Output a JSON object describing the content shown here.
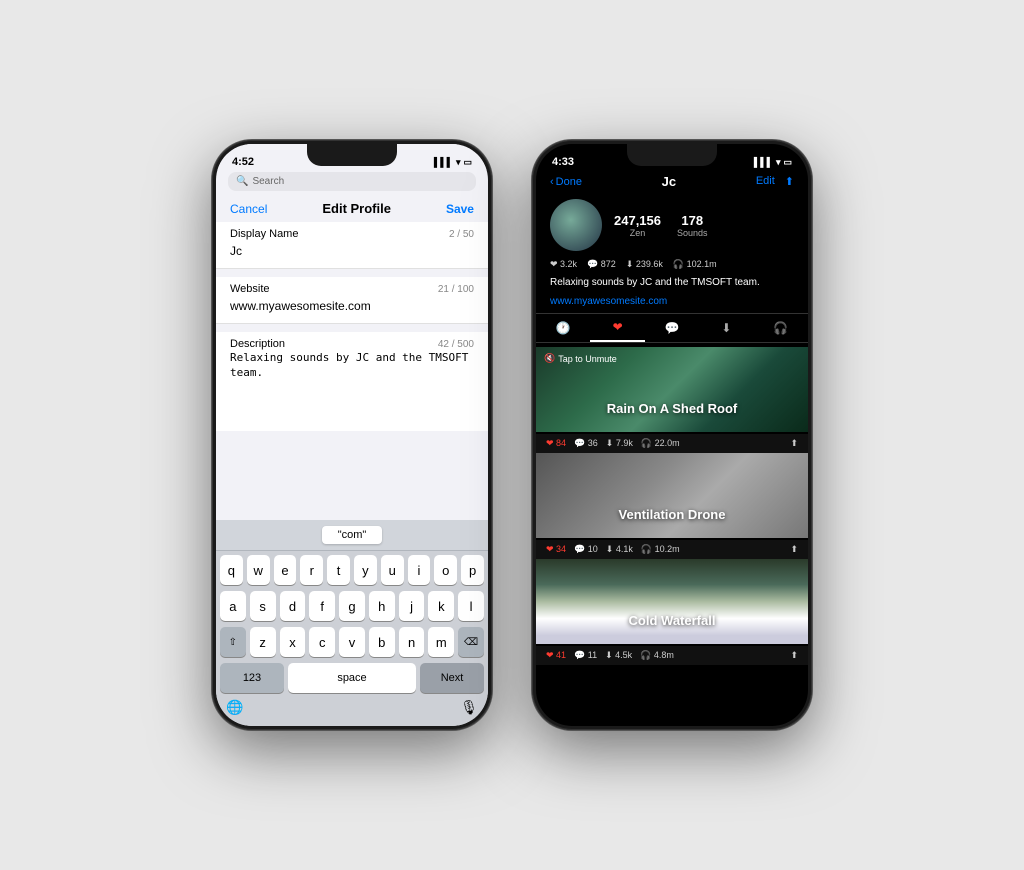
{
  "phone1": {
    "status_time": "4:52",
    "signal": "▌▌▌",
    "wifi": "WiFi",
    "battery": "Battery",
    "search_placeholder": "Search",
    "nav": {
      "cancel": "Cancel",
      "title": "Edit Profile",
      "save": "Save"
    },
    "form": {
      "display_name_label": "Display Name",
      "display_name_counter": "2 / 50",
      "display_name_value": "Jc",
      "website_label": "Website",
      "website_counter": "21 / 100",
      "website_value": "www.myawesomesite.com",
      "description_label": "Description",
      "description_counter": "42 / 500",
      "description_value": "Relaxing sounds by JC and the TMSOFT team."
    },
    "keyboard": {
      "suggestion": "\"com\"",
      "rows": [
        [
          "q",
          "w",
          "e",
          "r",
          "t",
          "y",
          "u",
          "i",
          "o",
          "p"
        ],
        [
          "a",
          "s",
          "d",
          "f",
          "g",
          "h",
          "j",
          "k",
          "l"
        ],
        [
          "⇧",
          "z",
          "x",
          "c",
          "v",
          "b",
          "n",
          "m",
          "⌫"
        ],
        [
          "123",
          "space",
          "Next"
        ]
      ]
    }
  },
  "phone2": {
    "status_time": "4:33",
    "nav": {
      "back": "Done",
      "title": "Jc",
      "edit": "Edit",
      "share": "↑"
    },
    "profile": {
      "zen_count": "247,156",
      "zen_label": "Zen",
      "sounds_count": "178",
      "sounds_label": "Sounds",
      "likes": "3.2k",
      "comments": "872",
      "downloads": "239.6k",
      "plays": "102.1m",
      "bio": "Relaxing sounds by JC and the TMSOFT team.",
      "website": "www.myawesomesite.com"
    },
    "sounds": [
      {
        "title": "Rain On A Shed Roof",
        "likes": "84",
        "comments": "36",
        "downloads": "7.9k",
        "plays": "22.0m",
        "bg": "rain",
        "unmute": "Tap to Unmute"
      },
      {
        "title": "Ventilation Drone",
        "likes": "34",
        "comments": "10",
        "downloads": "4.1k",
        "plays": "10.2m",
        "bg": "vent",
        "unmute": ""
      },
      {
        "title": "Cold Waterfall",
        "likes": "41",
        "comments": "11",
        "downloads": "4.5k",
        "plays": "4.8m",
        "bg": "water",
        "unmute": ""
      }
    ]
  }
}
